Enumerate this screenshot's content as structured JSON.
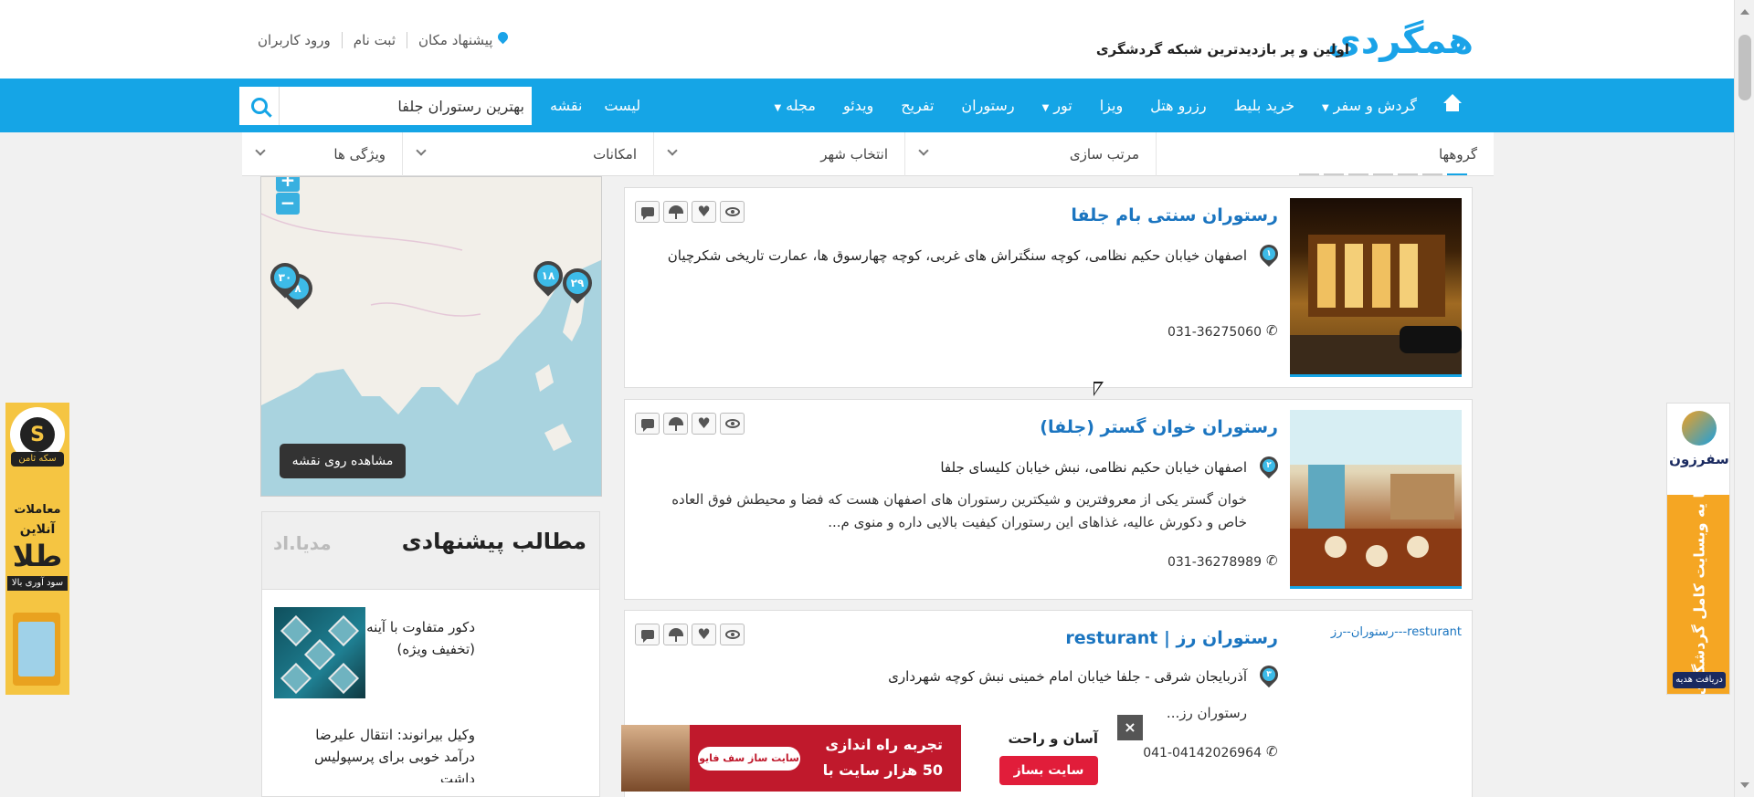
{
  "header": {
    "logo": "همگردی",
    "tagline": "اولین و پر بازدیدترین شبکه گردشگری",
    "links": [
      "پیشنهاد مکان",
      "ثبت نام",
      "ورود کاربران"
    ]
  },
  "nav": {
    "items": [
      {
        "label": "گردش و سفر",
        "dropdown": true
      },
      {
        "label": "خرید بلیط",
        "dropdown": false
      },
      {
        "label": "رزرو هتل",
        "dropdown": false
      },
      {
        "label": "ویزا",
        "dropdown": false
      },
      {
        "label": "تور",
        "dropdown": true
      },
      {
        "label": "رستوران",
        "dropdown": false
      },
      {
        "label": "تفریح",
        "dropdown": false
      },
      {
        "label": "ویدئو",
        "dropdown": false
      },
      {
        "label": "مجله",
        "dropdown": true
      }
    ],
    "view_list": "لیست",
    "view_map": "نقشه",
    "search_value": "بهترین رستوران جلفا"
  },
  "filters": {
    "groups": "گروهها",
    "sort": "مرتب سازی",
    "city": "انتخاب شهر",
    "facilities": "امکانات",
    "features": "ویژگی ها"
  },
  "map": {
    "zoom_in": "+",
    "zoom_out": "−",
    "markers": [
      "۳۰",
      "۸",
      "۱۸",
      "۲۹"
    ],
    "view_button": "مشاهده روی نقشه"
  },
  "suggested": {
    "title": "مطالب پیشنهادی",
    "brand": "مدیا.اد",
    "items": [
      {
        "text": "دکور متفاوت با آینه های مدرن!(تخفیف ویژه)"
      },
      {
        "text": "وکیل بیرانوند: انتقال علیرضا درآمد خوبی برای پرسپولیس داشت"
      }
    ]
  },
  "listings": [
    {
      "num": "۱",
      "title": "رستوران سنتی بام جلفا",
      "address": "اصفهان خیابان حکیم نظامی، کوچه سنگتراش های غربی، کوچه چهارسوق ها، عمارت تاریخی شکرچیان",
      "description": "",
      "phone": "031-36275060"
    },
    {
      "num": "۲",
      "title": "رستوران خوان گستر (جلفا)",
      "address": "اصفهان خیابان حکیم نظامی، نبش خیابان کلیسای جلفا",
      "description": "خوان گستر یکی از معروفترین و شیکترین رستوران های اصفهان هست که فضا و محیطش فوق العاده خاص و دکورش عالیه، غذاهای این رستوران کیفیت بالایی داره و منوی م...",
      "phone": "031-36278989"
    },
    {
      "num": "۳",
      "title": "رستوران رز | resturant",
      "slug": "رستوران--رز---resturant",
      "address": "آذربایجان شرقی - جلفا خیابان امام خمینی نبش کوچه شهرداری",
      "description": "رستوران رز...",
      "phone": "041-04142026964"
    }
  ],
  "ads": {
    "left": {
      "brand": "سکه ثامن",
      "line1": "معاملات",
      "line2": "آنلاین",
      "line3": "طلا",
      "line4": "سود آوری بالا"
    },
    "right": {
      "brand": "سفرزون",
      "vertical": "با یه وبسایت کامل گردشگری",
      "button": "دریافت هدیه"
    },
    "bottom": {
      "pill": "سایت ساز سف فایو",
      "line1": "تجربه راه اندازی",
      "line2": "50 هزار سایت با",
      "title": "آسان و راحت",
      "button": "سایت بساز",
      "close": "×"
    }
  }
}
